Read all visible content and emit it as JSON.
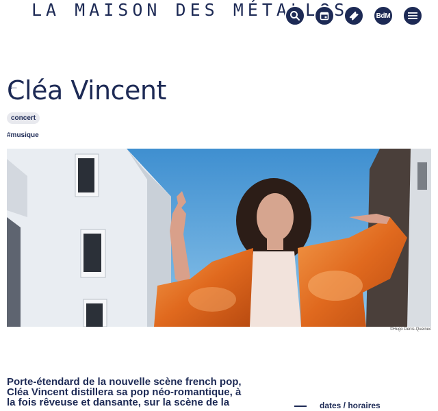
{
  "header": {
    "site_title": "LA MAISON DES MÉTALLOS",
    "nav": [
      {
        "icon": "search-icon"
      },
      {
        "icon": "calendar-icon"
      },
      {
        "icon": "ticket-icon"
      },
      {
        "icon": "bdm-icon",
        "label": "BdM"
      },
      {
        "icon": "menu-icon"
      }
    ],
    "accent_color": "#1d2a55"
  },
  "event": {
    "back_symbol": "←",
    "title": "Cléa Vincent",
    "tag": "concert",
    "hashtag": "#musique",
    "photo_credit": "©Hugo Denis-Queinec"
  },
  "description": {
    "intro": "Porte-étendard de la nouvelle scène french pop, Cléa Vincent distillera sa pop néo-romantique, à la fois rêveuse et dansante, sur la scène de la"
  },
  "sidebar": {
    "dates_label": "dates / horaires"
  }
}
